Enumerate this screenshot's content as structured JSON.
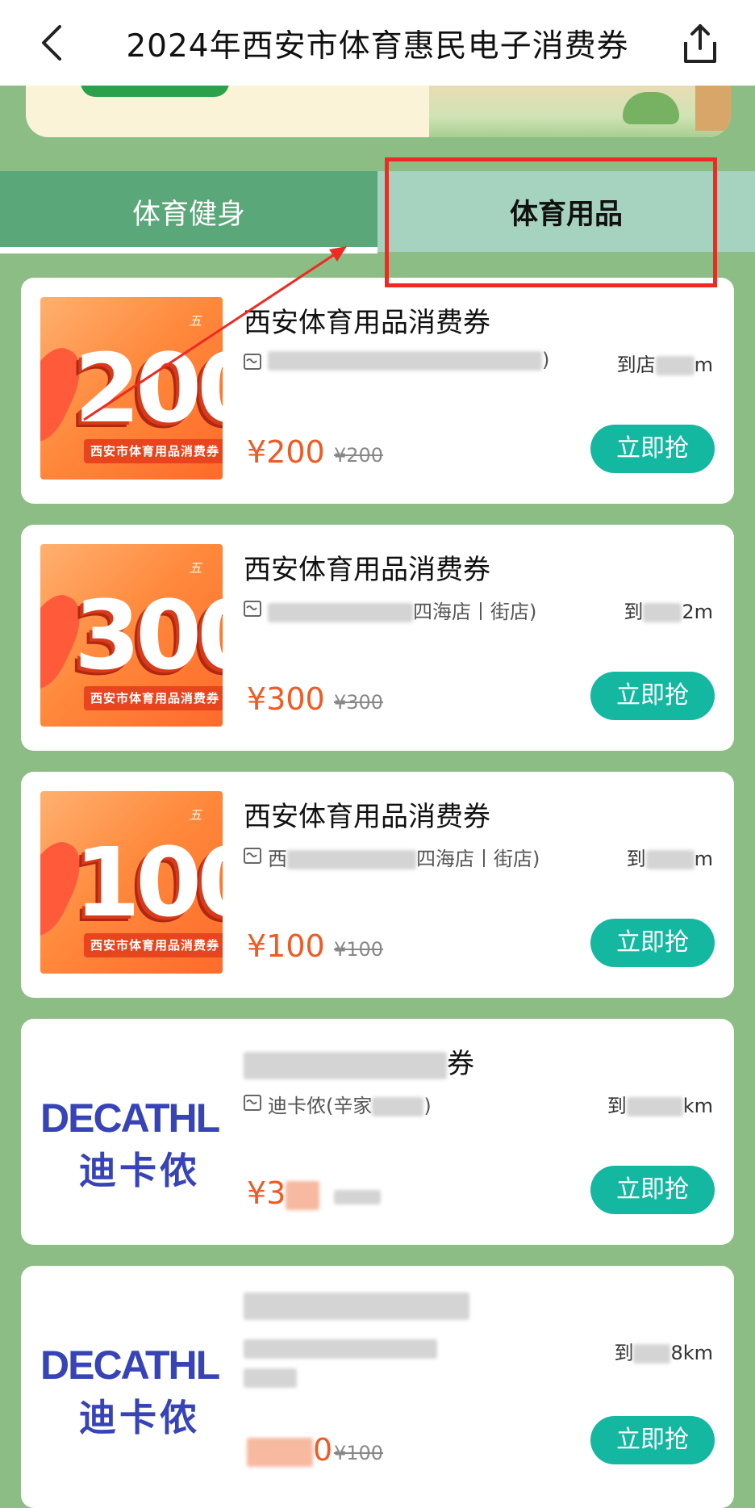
{
  "header": {
    "title": "2024年西安市体育惠民电子消费券"
  },
  "tabs": [
    {
      "label": "体育健身",
      "active": false
    },
    {
      "label": "体育用品",
      "active": true
    }
  ],
  "colors": {
    "accent": "#14b8a1",
    "price": "#f05a23",
    "highlight": "#ee2a22"
  },
  "cards": [
    {
      "thumb_number": "200",
      "thumb_brand": "五",
      "thumb_strip": "西安市体育用品消费券",
      "title": "西安体育用品消费券",
      "store_prefix": "",
      "store_suffix": ")",
      "dist_prefix": "到店",
      "dist_suffix": "m",
      "price": "¥200",
      "original": "¥200",
      "button": "立即抢"
    },
    {
      "thumb_number": "300",
      "thumb_brand": "五",
      "thumb_strip": "西安市体育用品消费券",
      "title": "西安体育用品消费券",
      "store_prefix": "",
      "store_suffix": "四海店丨街店)",
      "dist_prefix": "到",
      "dist_suffix": "2m",
      "price": "¥300",
      "original": "¥300",
      "button": "立即抢"
    },
    {
      "thumb_number": "100",
      "thumb_brand": "五",
      "thumb_strip": "西安市体育用品消费券",
      "title": "西安体育用品消费券",
      "store_prefix": "西",
      "store_suffix": "四海店丨街店)",
      "dist_prefix": "到",
      "dist_suffix": "m",
      "price": "¥100",
      "original": "¥100",
      "button": "立即抢"
    },
    {
      "brand_word": "DECATHL",
      "brand_cn": "迪卡侬",
      "title_suffix": "券",
      "store_prefix": "迪卡侬(辛家",
      "store_suffix": ")",
      "dist_prefix": "到",
      "dist_suffix": "km",
      "price": "¥3",
      "original": "",
      "button": "立即抢"
    },
    {
      "brand_word": "DECATHL",
      "brand_cn": "迪卡侬",
      "title_suffix": "",
      "store_prefix": "",
      "store_suffix": "",
      "dist_prefix": "到",
      "dist_suffix": "8km",
      "price": "0",
      "original": "¥100",
      "button": "立即抢"
    }
  ]
}
